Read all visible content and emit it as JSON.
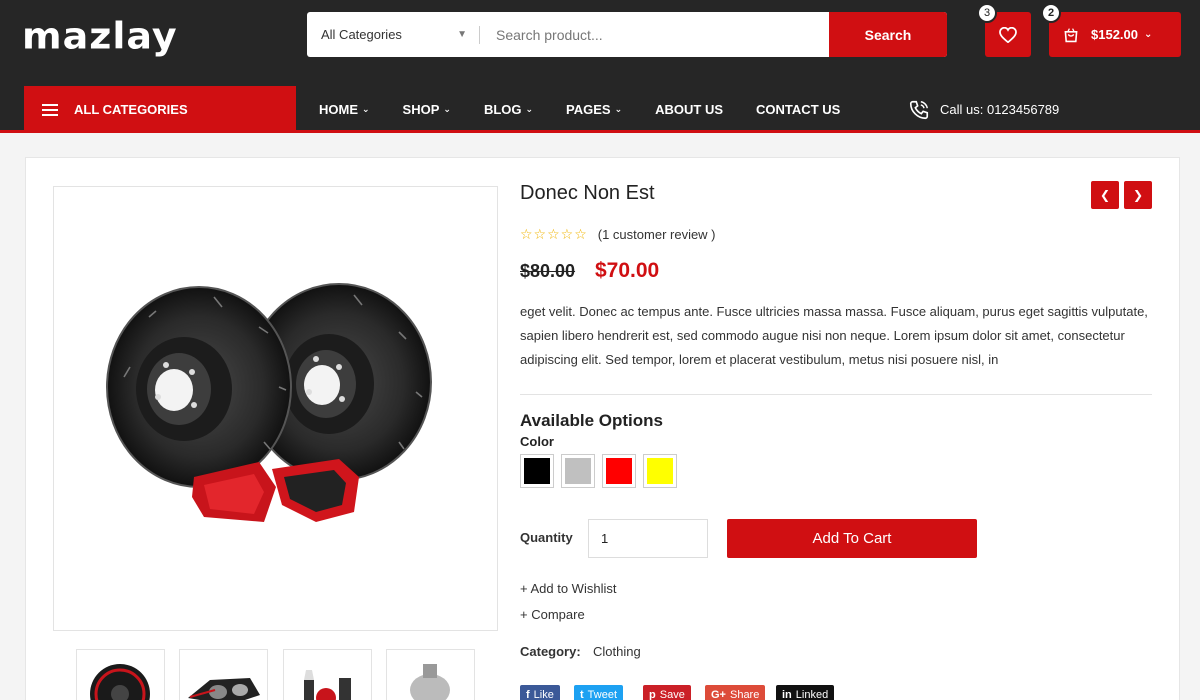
{
  "header": {
    "logo": "mazlay",
    "search": {
      "category": "All Categories",
      "placeholder": "Search product...",
      "button": "Search"
    },
    "wishlist": {
      "count": "3"
    },
    "cart": {
      "count": "2",
      "amount": "$152.00"
    }
  },
  "nav": {
    "all_categories": "ALL CATEGORIES",
    "items": [
      {
        "label": "HOME",
        "dropdown": true
      },
      {
        "label": "SHOP",
        "dropdown": true
      },
      {
        "label": "BLOG",
        "dropdown": true
      },
      {
        "label": "PAGES",
        "dropdown": true
      },
      {
        "label": "ABOUT US",
        "dropdown": false
      },
      {
        "label": "CONTACT US",
        "dropdown": false
      }
    ],
    "call": "Call us: 0123456789"
  },
  "product": {
    "title": "Donec Non Est",
    "rating": {
      "stars": 0,
      "max": 5,
      "text": "(1 customer review )"
    },
    "old_price": "$80.00",
    "price": "$70.00",
    "description": "eget velit. Donec ac tempus ante. Fusce ultricies massa massa. Fusce aliquam, purus eget sagittis vulputate, sapien libero hendrerit est, sed commodo augue nisi non neque. Lorem ipsum dolor sit amet, consectetur adipiscing elit. Sed tempor, lorem et placerat vestibulum, metus nisi posuere nisl, in",
    "options_title": "Available Options",
    "color_label": "Color",
    "colors": [
      "#000000",
      "#c0c0c0",
      "#ff0000",
      "#ffff00"
    ],
    "quantity_label": "Quantity",
    "quantity": "1",
    "add_to_cart": "Add To Cart",
    "add_to_wishlist": "+ Add to Wishlist",
    "compare": "+ Compare",
    "category_label": "Category:",
    "category": "Clothing",
    "share": [
      {
        "label": "Like",
        "icon": "f",
        "color": "#3b5998"
      },
      {
        "label": "Tweet",
        "icon": "t",
        "color": "#1da1f2"
      },
      {
        "label": "Save",
        "icon": "p",
        "color": "#cb2027"
      },
      {
        "label": "Share",
        "icon": "G+",
        "color": "#dd4b39"
      },
      {
        "label": "Linked",
        "icon": "in",
        "color": "#111111"
      }
    ]
  },
  "colors": {
    "accent": "#d00f12",
    "header_bg": "#262626"
  }
}
